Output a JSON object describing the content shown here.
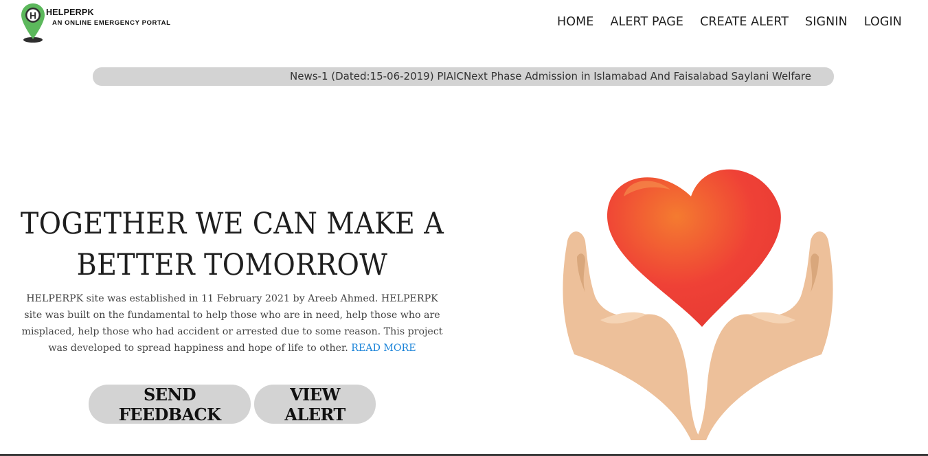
{
  "logo": {
    "name": "HELPERPK",
    "tagline": "AN ONLINE EMERGENCY PORTAL",
    "icon": "map-pin-h-icon",
    "colors": {
      "pin": "#5cb85c",
      "pin_dark": "#2e2e2e"
    }
  },
  "nav": {
    "items": [
      {
        "label": "HOME"
      },
      {
        "label": "ALERT PAGE"
      },
      {
        "label": "CREATE ALERT"
      },
      {
        "label": "SIGNIN"
      },
      {
        "label": "LOGIN"
      }
    ]
  },
  "ticker": {
    "text": "News-1 (Dated:15-06-2019) PIAICNext Phase Admission in Islamabad And Faisalabad Saylani Welfare"
  },
  "hero": {
    "title": "TOGETHER WE CAN MAKE A BETTER TOMORROW",
    "description": "HELPERPK site was established in 11 February 2021 by Areeb Ahmed. HELPERPK site was built on the fundamental to help those who are in need, help those who are misplaced, help those who had accident or arrested due to some reason. This project was developed to spread happiness and hope of life to other.",
    "read_more": "READ MORE",
    "buttons": {
      "feedback": "SEND FEEDBACK",
      "view_alert": "VIEW ALERT"
    },
    "illustration": "hands-holding-heart-icon"
  },
  "colors": {
    "ticker_bg": "#d3d3d3",
    "button_bg": "#d3d3d3",
    "link": "#1a83d8",
    "heart": "#ef4136",
    "skin": "#edc09a"
  }
}
